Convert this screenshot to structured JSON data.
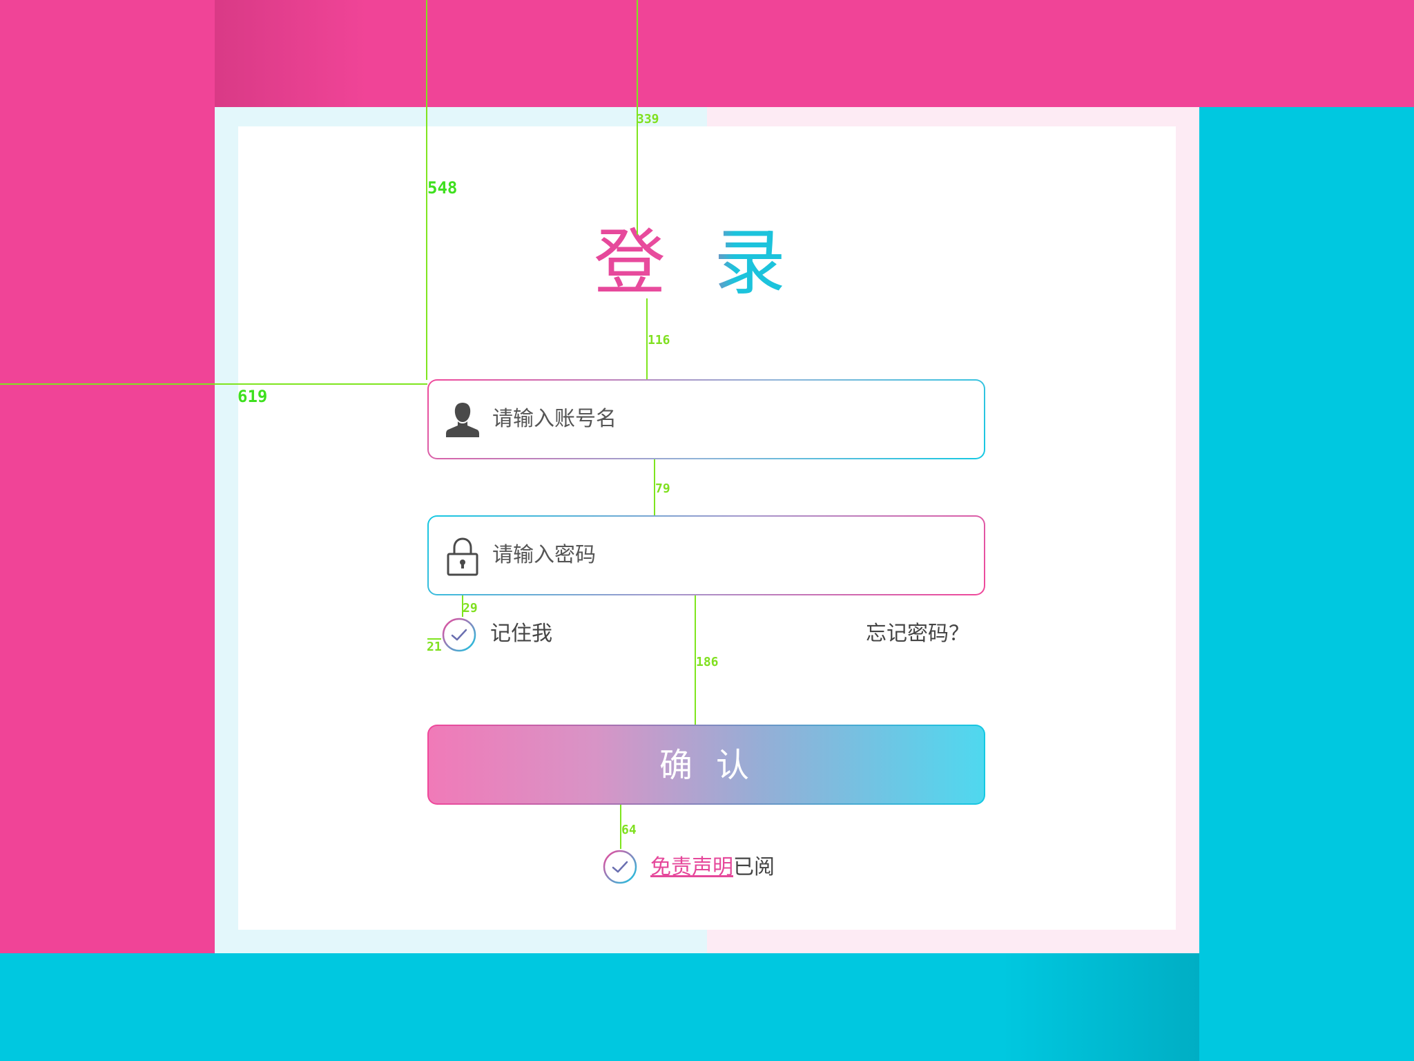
{
  "title": "登录",
  "username": {
    "placeholder": "请输入账号名",
    "icon": "user-icon"
  },
  "password": {
    "placeholder": "请输入密码",
    "icon": "lock-icon"
  },
  "remember": {
    "label": "记住我",
    "checked": true
  },
  "forgot": {
    "label": "忘记密码？"
  },
  "confirm": {
    "label": "确认"
  },
  "disclaimer": {
    "link": "免责声明",
    "suffix": "已阅",
    "checked": true
  },
  "annotations": [
    "339",
    "548",
    "116",
    "619",
    "79",
    "29",
    "21",
    "186",
    "64"
  ],
  "colors": {
    "pink": "#f04497",
    "cyan": "#00c8e0",
    "measure": "#7ee51e"
  }
}
